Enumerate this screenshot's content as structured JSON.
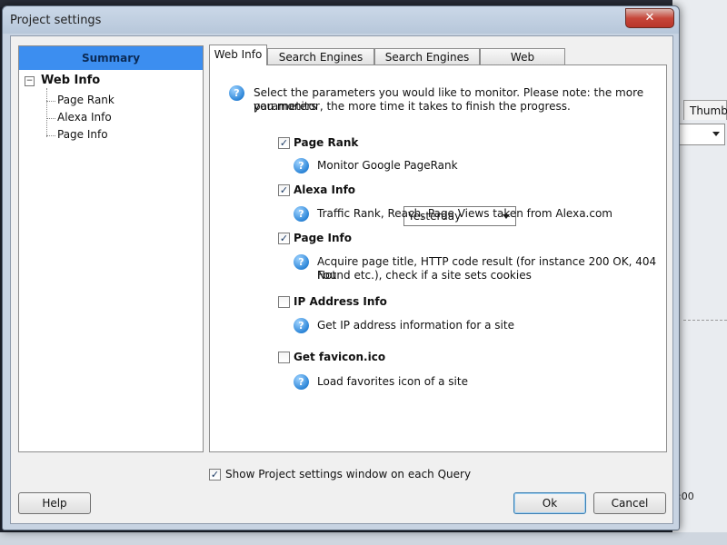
{
  "background": {
    "tab_label": "Thumb",
    "time_text": ":00"
  },
  "dialog": {
    "title": "Project settings",
    "close_symbol": "✕"
  },
  "tree": {
    "header": "Summary",
    "expander": "−",
    "root": "Web Info",
    "children": [
      "Page Rank",
      "Alexa Info",
      "Page Info"
    ]
  },
  "tabs": [
    "Web Info",
    "Search Engines Info",
    "Search Engines List",
    "Web Directories"
  ],
  "intro": {
    "icon": "info-icon",
    "line1": "Select the parameters you would like to monitor. Please note: the more parameters",
    "line2": "you monitor, the more time it takes to finish the progress."
  },
  "params": [
    {
      "label": "Page Rank",
      "checked": true,
      "desc1": "Monitor Google PageRank",
      "desc2": ""
    },
    {
      "label": "Alexa Info",
      "checked": true,
      "desc1": "Traffic Rank, Reach, Page Views taken from Alexa.com",
      "desc2": ""
    },
    {
      "label": "Page Info",
      "checked": true,
      "desc1": "Acquire page title, HTTP code result (for instance 200 OK, 404 Not",
      "desc2": "Found etc.), check if a site sets cookies"
    },
    {
      "label": "IP Address Info",
      "checked": false,
      "desc1": "Get IP address information for a site",
      "desc2": ""
    },
    {
      "label": "Get favicon.ico",
      "checked": false,
      "desc1": "Load favorites icon of a site",
      "desc2": ""
    }
  ],
  "alexa_period": "Yesterday",
  "info_glyph": "?",
  "check_glyph": "✓",
  "show_each_query": {
    "label": "Show Project settings window on each Query",
    "checked": true
  },
  "buttons": {
    "help": "Help",
    "ok": "Ok",
    "cancel": "Cancel"
  },
  "colors": {
    "summary_header": "#3c8ef0",
    "info_icon": "#2d86d8",
    "close_button": "#c7473a"
  }
}
